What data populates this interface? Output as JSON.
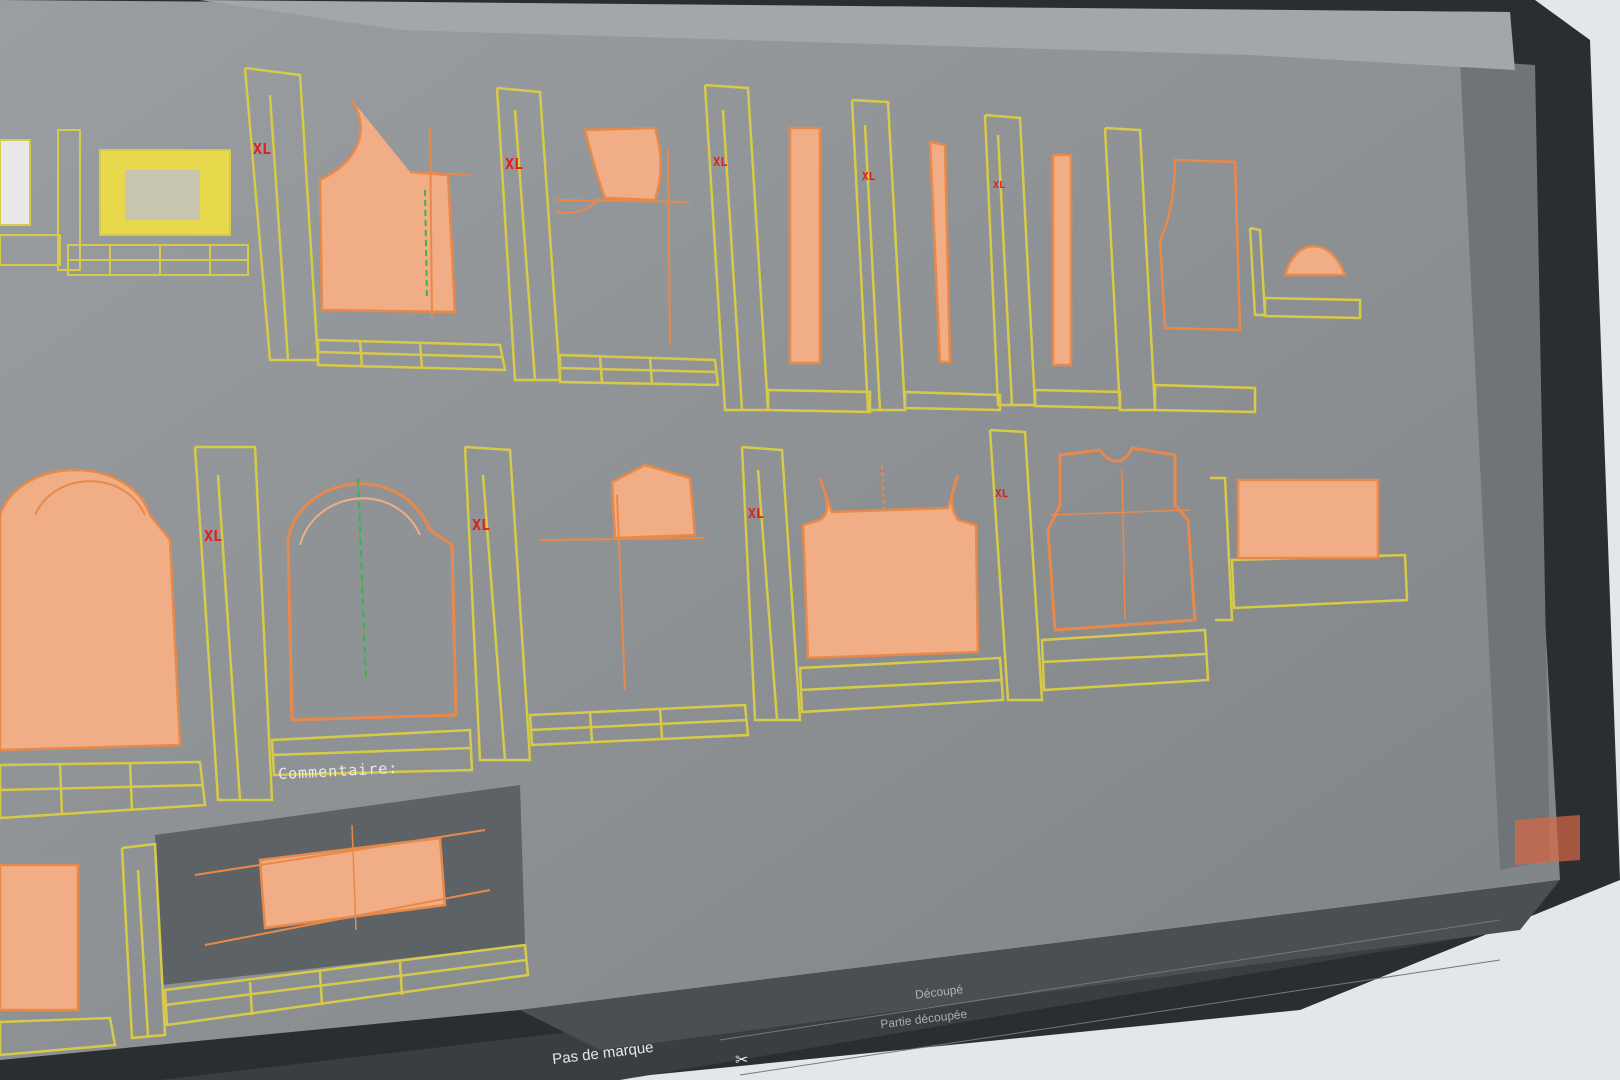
{
  "app": {
    "colors": {
      "screen_bg": "#8f9396",
      "bezel": "#23272a",
      "frame": "#d7c94a",
      "piece_fill": "#f1ad85",
      "piece_stroke": "#e8894a",
      "size_label": "#e0201c",
      "grain_line": "#3bb54a",
      "selection_bg": "#5c6265"
    }
  },
  "pieces_row1": [
    {
      "size": "XL"
    },
    {
      "size": "XL"
    },
    {
      "size": "XL"
    },
    {
      "size": "XL"
    },
    {
      "size": "XL"
    }
  ],
  "pieces_row2": [
    {
      "size": "XL"
    },
    {
      "size": "XL"
    },
    {
      "size": "XL"
    },
    {
      "size": "XL"
    }
  ],
  "comment_label": "Commentaire:",
  "status_bar": {
    "marker_text": "Pas de marque",
    "cut_label": "Découpé",
    "cut_parts_label": "Partie découpée"
  },
  "icons": [
    "scissors-icon"
  ]
}
